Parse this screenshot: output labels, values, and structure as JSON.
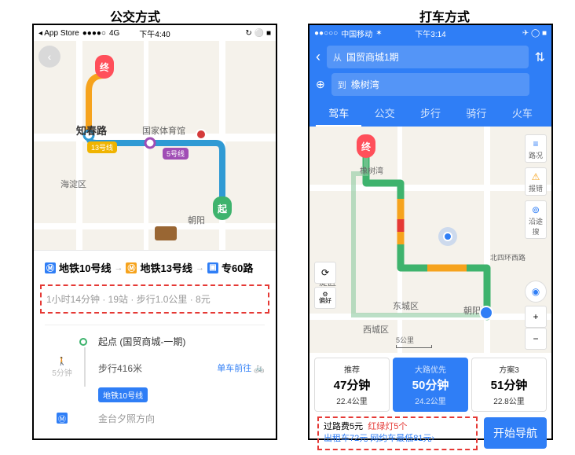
{
  "titles": {
    "left": "公交方式",
    "right": "打车方式"
  },
  "left": {
    "status": {
      "back": "App Store",
      "signal": "●●●●○",
      "net": "4G",
      "time": "下午4:40",
      "battery": "■"
    },
    "map": {
      "back_icon": "‹",
      "labels": {
        "zhichunlu": "知春路",
        "guojiatyg": "国家体育馆",
        "haidian": "海淀区",
        "chaoyang": "朝阳"
      },
      "metro13": "13号线",
      "metro5": "5号线",
      "marker_end": "终",
      "marker_start": "起"
    },
    "transit": {
      "seg1": "地铁10号线",
      "seg2": "地铁13号线",
      "seg3": "专60路",
      "arrow": "→",
      "summary": "1小时14分钟 · 19站 · 步行1.0公里 · 8元"
    },
    "steps": {
      "walk_time": "5分钟",
      "origin_label": "起点 (国贸商城-一期)",
      "walk_dist": "步行416米",
      "bike": "单车前往",
      "line_chip": "地铁10号线",
      "direction": "金台夕照方向"
    }
  },
  "right": {
    "status": {
      "signal": "●●○○○",
      "carrier": "中国移动",
      "wifi": "✶",
      "time": "下午3:14",
      "icons": "✈ ◯ ■"
    },
    "header": {
      "back": "‹",
      "swap": "⇅",
      "add": "⊕",
      "from_label": "从",
      "from_value": "国贸商城1期",
      "to_label": "到",
      "to_value": "橡树湾",
      "tabs": [
        "驾车",
        "公交",
        "步行",
        "骑行",
        "火车"
      ]
    },
    "map": {
      "marker_end": "终",
      "labels": {
        "xiangshuwan": "橡树湾",
        "haidian": "淀区",
        "dongcheng": "东城区",
        "xicheng": "西城区",
        "chaoyang": "朝阳区",
        "road": "北四环西路"
      },
      "tools": {
        "traffic": "路况",
        "report": "报错",
        "follow": "沿途搜"
      },
      "refresh": "⟳",
      "pref": "偏好",
      "loc": "◉",
      "plus": "+",
      "minus": "−",
      "scale": "5公里"
    },
    "options": [
      {
        "tag": "推荐",
        "time": "47分钟",
        "dist": "22.4公里"
      },
      {
        "tag": "大路优先",
        "time": "50分钟",
        "dist": "24.2公里"
      },
      {
        "tag": "方案3",
        "time": "51分钟",
        "dist": "22.8公里"
      }
    ],
    "footer": {
      "line1a": "过路费5元",
      "line1b": "红绿灯5个",
      "line2": "出租车72元 网约车最低81元›",
      "nav": "开始导航"
    }
  }
}
